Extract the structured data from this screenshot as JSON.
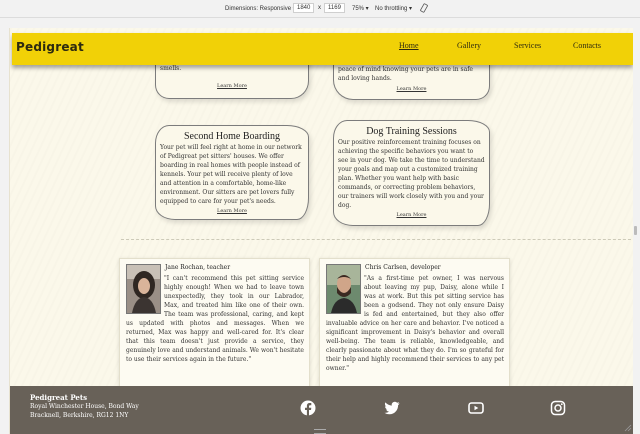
{
  "devtools": {
    "dimensions_label": "Dimensions: Responsive",
    "width": "1840",
    "times": "x",
    "height": "1169",
    "zoom": "75%",
    "throttle": "No throttling"
  },
  "header": {
    "brand": "Pedigreat",
    "nav": [
      {
        "label": "Home",
        "active": true
      },
      {
        "label": "Gallery",
        "active": false
      },
      {
        "label": "Services",
        "active": false
      },
      {
        "label": "Contacts",
        "active": false
      }
    ]
  },
  "top_cards": {
    "left_text": "stimulation so they explore new sights and smells.",
    "right_text": "peace of mind knowing your pets are in safe and loving hands.",
    "learn_more": "Learn More"
  },
  "services": [
    {
      "title": "Second Home Boarding",
      "text": "Your pet will feel right at home in our network of Pedigreat pet sitters' houses. We offer boarding in real homes with people instead of kennels. Your pet will receive plenty of love and attention in a comfortable, home-like environment. Our sitters are pet lovers fully equipped to care for your pet's needs.",
      "link": "Learn More"
    },
    {
      "title": "Dog Training Sessions",
      "text": "Our positive reinforcement training focuses on achieving the specific behaviors you want to see in your dog. We take the time to understand your goals and map out a customized training plan. Whether you want help with basic commands, or correcting problem behaviors, our trainers will work closely with you and your dog.",
      "link": "Learn More"
    }
  ],
  "testimonials": [
    {
      "name": "Jane Rochan, teacher",
      "quote": "\"I can't recommend this pet sitting service highly enough! When we had to leave town unexpectedly, they took in our Labrador, Max, and treated him like one of their own. The team was professional, caring, and kept us updated with photos and messages. When we returned, Max was happy and well-cared for. It's clear that this team doesn't just provide a service, they genuinely love and understand animals. We won't hesitate to use their services again in the future.\""
    },
    {
      "name": "Chris Carlsen, developer",
      "quote": "\"As a first-time pet owner, I was nervous about leaving my pup, Daisy, alone while I was at work. But this pet sitting service has been a godsend. They not only ensure Daisy is fed and entertained, but they also offer invaluable advice on her care and behavior. I've noticed a significant improvement in Daisy's behavior and overall well-being. The team is reliable, knowledgeable, and clearly passionate about what they do. I'm so grateful for their help and highly recommend their services to any pet owner.\""
    }
  ],
  "footer": {
    "title": "Pedigreat Pets",
    "address_line1": "Royal Winchester House, Bond Way",
    "address_line2": "Bracknell, Berkshire, RG12 1NY",
    "social": [
      "facebook-icon",
      "twitter-icon",
      "youtube-icon",
      "instagram-icon"
    ]
  },
  "colors": {
    "header": "#f1d107",
    "page_bg": "#fbf8ea",
    "footer": "#686158"
  }
}
